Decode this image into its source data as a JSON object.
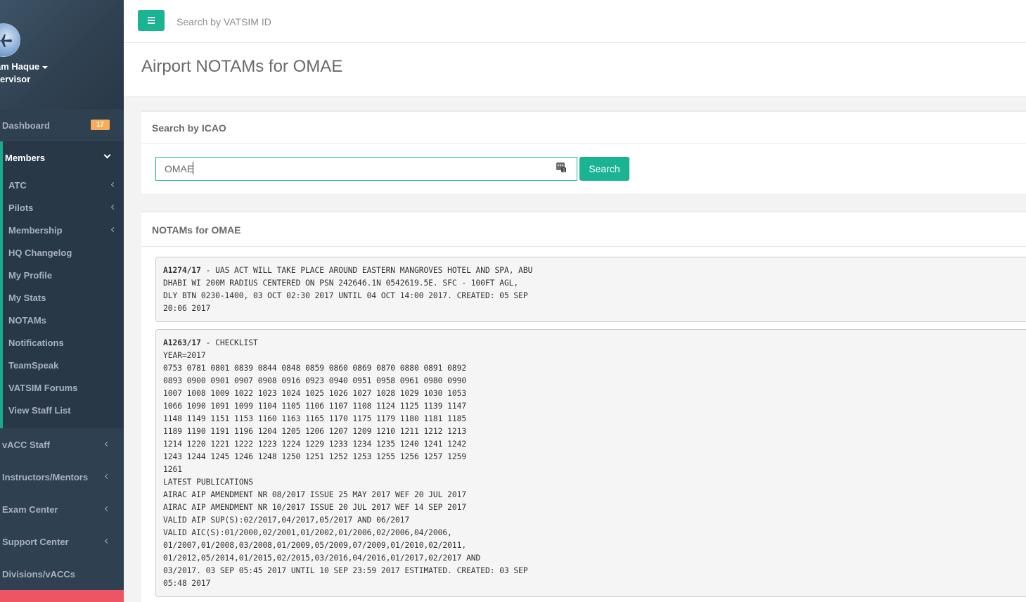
{
  "sidebar": {
    "profile": {
      "name": "am Haque",
      "role": "pervisor"
    },
    "dashboard": {
      "label": "Dashboard",
      "badge": "17"
    },
    "members": {
      "label": "Members",
      "items": [
        {
          "label": "ATC"
        },
        {
          "label": "Pilots"
        },
        {
          "label": "Membership"
        },
        {
          "label": "HQ Changelog"
        },
        {
          "label": "My Profile"
        },
        {
          "label": "My Stats"
        },
        {
          "label": "NOTAMs"
        },
        {
          "label": "Notifications"
        },
        {
          "label": "TeamSpeak"
        },
        {
          "label": "VATSIM Forums"
        },
        {
          "label": "View Staff List"
        }
      ]
    },
    "sections": [
      {
        "label": "vACC Staff"
      },
      {
        "label": "Instructors/Mentors"
      },
      {
        "label": "Exam Center"
      },
      {
        "label": "Support Center"
      },
      {
        "label": "Divisions/vACCs"
      }
    ]
  },
  "topbar": {
    "search_placeholder": "Search by VATSIM ID"
  },
  "page": {
    "title": "Airport NOTAMs for OMAE"
  },
  "icao_search": {
    "title": "Search by ICAO",
    "value": "OMAE",
    "button": "Search"
  },
  "notams": {
    "title": "NOTAMs for OMAE",
    "items": [
      {
        "id": "A1274/17",
        "text": " - UAS ACT WILL TAKE PLACE AROUND EASTERN MANGROVES HOTEL AND SPA, ABU\nDHABI WI 200M RADIUS CENTERED ON PSN 242646.1N 0542619.5E. SFC - 100FT AGL,\nDLY BTN 0230-1400, 03 OCT 02:30 2017 UNTIL 04 OCT 14:00 2017. CREATED: 05 SEP\n20:06 2017"
      },
      {
        "id": "A1263/17",
        "text": " - CHECKLIST\nYEAR=2017\n0753 0781 0801 0839 0844 0848 0859 0860 0869 0870 0880 0891 0892\n0893 0900 0901 0907 0908 0916 0923 0940 0951 0958 0961 0980 0990\n1007 1008 1009 1022 1023 1024 1025 1026 1027 1028 1029 1030 1053\n1066 1090 1091 1099 1104 1105 1106 1107 1108 1124 1125 1139 1147\n1148 1149 1151 1153 1160 1163 1165 1170 1175 1179 1180 1181 1185\n1189 1190 1191 1196 1204 1205 1206 1207 1209 1210 1211 1212 1213\n1214 1220 1221 1222 1223 1224 1229 1233 1234 1235 1240 1241 1242\n1243 1244 1245 1246 1248 1250 1251 1252 1253 1255 1256 1257 1259\n1261\nLATEST PUBLICATIONS\nAIRAC AIP AMENDMENT NR 08/2017 ISSUE 25 MAY 2017 WEF 20 JUL 2017\nAIRAC AIP AMENDMENT NR 10/2017 ISSUE 20 JUL 2017 WEF 14 SEP 2017\nVALID AIP SUP(S):02/2017,04/2017,05/2017 AND 06/2017\nVALID AIC(S):01/2000,02/2001,01/2002,01/2006,02/2006,04/2006,\n01/2007,01/2008,03/2008,01/2009,05/2009,07/2009,01/2010,02/2011,\n01/2012,05/2014,01/2015,02/2015,03/2016,04/2016,01/2017,02/2017 AND\n03/2017. 03 SEP 05:45 2017 UNTIL 10 SEP 23:59 2017 ESTIMATED. CREATED: 03 SEP\n05:48 2017"
      }
    ]
  },
  "colors": {
    "sidebar": "#2f4050",
    "accent": "#1ab394",
    "badge": "#f8ac59",
    "danger": "#ed5565"
  }
}
